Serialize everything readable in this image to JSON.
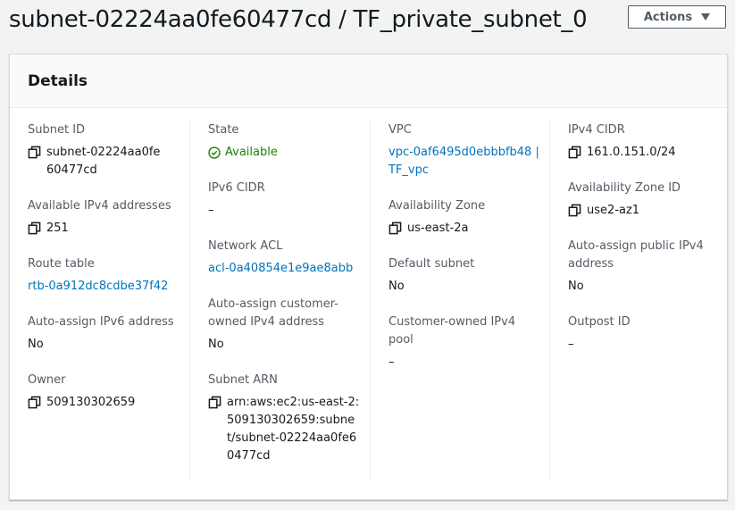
{
  "header": {
    "title": "subnet-02224aa0fe60477cd / TF_private_subnet_0",
    "actions_label": "Actions"
  },
  "panel": {
    "title": "Details"
  },
  "fields": {
    "subnet_id": {
      "label": "Subnet ID",
      "value": "subnet-02224aa0fe60477cd",
      "icon": "copy-icon"
    },
    "available_ipv4": {
      "label": "Available IPv4 addresses",
      "value": "251",
      "icon": "copy-icon"
    },
    "route_table": {
      "label": "Route table",
      "value": "rtb-0a912dc8cdbe37f42"
    },
    "auto_ipv6": {
      "label": "Auto-assign IPv6 address",
      "value": "No"
    },
    "owner": {
      "label": "Owner",
      "value": "509130302659",
      "icon": "copy-icon"
    },
    "state": {
      "label": "State",
      "value": "Available",
      "icon": "check-circle-icon",
      "color": "#1d8102"
    },
    "ipv6_cidr": {
      "label": "IPv6 CIDR",
      "value": "–"
    },
    "network_acl": {
      "label": "Network ACL",
      "value": "acl-0a40854e1e9ae8abb"
    },
    "auto_customer_ipv4": {
      "label": "Auto-assign customer-owned IPv4 address",
      "value": "No"
    },
    "subnet_arn": {
      "label": "Subnet ARN",
      "value": "arn:aws:ec2:us-east-2:509130302659:subnet/subnet-02224aa0fe60477cd",
      "icon": "copy-icon"
    },
    "vpc": {
      "label": "VPC",
      "value": "vpc-0af6495d0ebbbfb48 | TF_vpc"
    },
    "availability_zone": {
      "label": "Availability Zone",
      "value": "us-east-2a",
      "icon": "copy-icon"
    },
    "default_subnet": {
      "label": "Default subnet",
      "value": "No"
    },
    "customer_ipv4_pool": {
      "label": "Customer-owned IPv4 pool",
      "value": "–"
    },
    "ipv4_cidr": {
      "label": "IPv4 CIDR",
      "value": "161.0.151.0/24",
      "icon": "copy-icon"
    },
    "az_id": {
      "label": "Availability Zone ID",
      "value": "use2-az1",
      "icon": "copy-icon"
    },
    "auto_public_ipv4": {
      "label": "Auto-assign public IPv4 address",
      "value": "No"
    },
    "outpost_id": {
      "label": "Outpost ID",
      "value": "–"
    }
  },
  "colors": {
    "link": "#0073bb",
    "status_ok": "#1d8102",
    "label": "#545b64"
  }
}
